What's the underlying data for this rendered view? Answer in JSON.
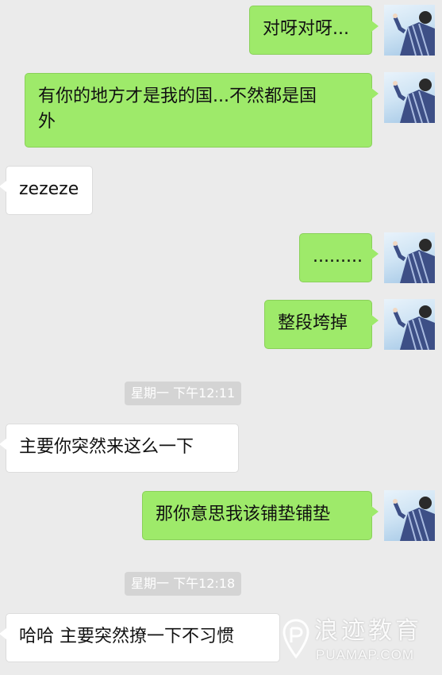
{
  "messages": [
    {
      "side": "out",
      "text": "对呀对呀..."
    },
    {
      "side": "out",
      "text": "有你的地方才是我的国...不然都是国\n外"
    },
    {
      "side": "in",
      "text": "zezeze"
    },
    {
      "side": "out",
      "text": "........."
    },
    {
      "side": "out",
      "text": "整段垮掉"
    },
    {
      "type": "time",
      "text": "星期一 下午12:11"
    },
    {
      "side": "in",
      "text": "主要你突然来这么一下"
    },
    {
      "side": "out",
      "text": "那你意思我该铺垫铺垫"
    },
    {
      "type": "time",
      "text": "星期一 下午12:18"
    },
    {
      "side": "in",
      "text": "哈哈 主要突然撩一下不习惯"
    }
  ],
  "watermark": {
    "chinese": "浪迹教育",
    "english": "PUAMAP.COM"
  },
  "colors": {
    "background": "#ebebeb",
    "outgoing_bubble": "#9eea6a",
    "incoming_bubble": "#ffffff",
    "timestamp_bg": "#d4d4d4"
  },
  "icons": {
    "avatar": "user-avatar-photo",
    "watermark": "location-pin-icon"
  }
}
